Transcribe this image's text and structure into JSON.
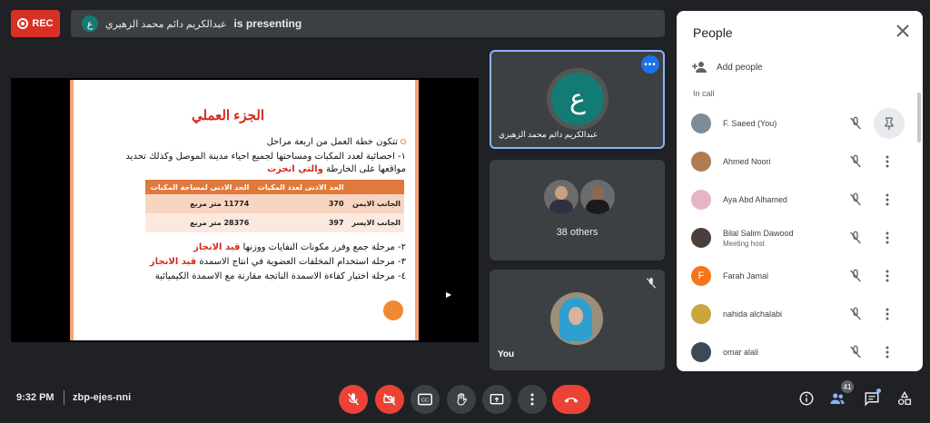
{
  "top": {
    "rec_label": "REC",
    "presenter_initial": "ع",
    "presenter_name": "عبدالكريم دائم محمد الزهيري",
    "presenting_suffix": "is presenting"
  },
  "slide": {
    "title": "الجزء العملي",
    "line1": "تتكون خطة العمل من اربعة مراحل",
    "line2": "١- احصائية لعدد المكبات ومساحتها لجميع احياء مدينة الموصل وكذلك تحديد",
    "line3_main": "مواقعها على الخارطة ",
    "line3_red": "والتي انجزت",
    "table": {
      "headers": [
        "",
        "الحد الادنى لعدد المكبات",
        "الحد الادنى لمساحة المكبات"
      ],
      "rows": [
        [
          "الجانب الايمن",
          "370",
          "11774 متر مربع"
        ],
        [
          "الجانب الايسر",
          "397",
          "28376 متر مربع"
        ]
      ]
    },
    "step2_main": "٢- مرحلة جمع وفرز مكونات النفايات ووزنها ",
    "step2_red": "قيد الانجاز",
    "step3_main": "٣- مرحلة استخدام المخلفات العضوية في انتاج الاسمدة ",
    "step3_red": "قيد الانجاز",
    "step4": "٤- مرحلة اختبار كفاءة الاسمدة الناتجة مقارنة مع الاسمدة الكيميائية"
  },
  "tiles": {
    "presenter_initial": "ع",
    "presenter_name": "عبدالكريم دائم محمد الزهيري",
    "others_label": "38 others",
    "you_label": "You"
  },
  "panel": {
    "title": "People",
    "add_people": "Add people",
    "in_call": "In call",
    "people": [
      {
        "name": "F. Saeed (You)",
        "sub": ""
      },
      {
        "name": "Ahmed Noori",
        "sub": ""
      },
      {
        "name": "Aya Abd Alhamed",
        "sub": ""
      },
      {
        "name": "Bilal Salim Dawood",
        "sub": "Meeting host"
      },
      {
        "name": "Farah Jamal",
        "sub": "",
        "initial": "F"
      },
      {
        "name": "nahida alchalabi",
        "sub": ""
      },
      {
        "name": "omar alali",
        "sub": ""
      }
    ]
  },
  "bottom": {
    "time": "9:32 PM",
    "meeting_code": "zbp-ejes-nni",
    "participants_count": "41"
  },
  "colors": {
    "accent_blue": "#8ab4f8",
    "danger_red": "#ea4335",
    "presenter_teal": "#137b74",
    "slide_red": "#d52a1c"
  }
}
